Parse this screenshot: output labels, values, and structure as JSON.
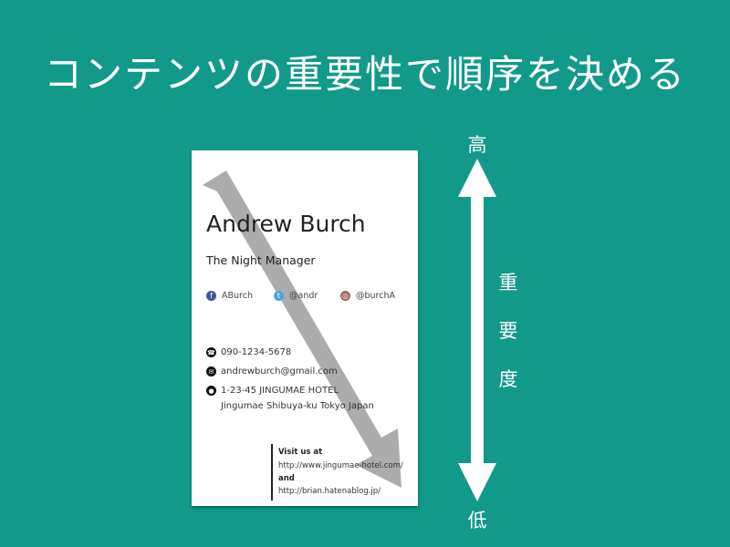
{
  "slide": {
    "title": "コンテンツの重要性で順序を決める"
  },
  "card": {
    "name": "Andrew Burch",
    "role": "The Night Manager",
    "social": [
      {
        "icon": "facebook-icon",
        "glyph": "f",
        "color": "#3b5998",
        "handle": "ABurch"
      },
      {
        "icon": "twitter-icon",
        "glyph": "t",
        "color": "#4aa3df",
        "handle": "@andr"
      },
      {
        "icon": "instagram-icon",
        "glyph": "◎",
        "color": "#a0675a",
        "handle": "@burchA"
      }
    ],
    "phone": "090-1234-5678",
    "email": "andrewburch@gmail.com",
    "address_line1": "1-23-45 JINGUMAE HOTEL",
    "address_line2": "Jingumae Shibuya-ku Tokyo Japan",
    "visit_heading": "Visit us at",
    "url1": "http://www.jingumae-hotel.com/",
    "and_text": "and",
    "url2": "http://brian.hatenablog.jp/"
  },
  "scale": {
    "top_label": "高",
    "axis_label_1": "重",
    "axis_label_2": "要",
    "axis_label_3": "度",
    "bottom_label": "低"
  },
  "colors": {
    "background": "#12998a",
    "arrow_gray": "#a6a6a6",
    "scale_white": "#ffffff"
  }
}
